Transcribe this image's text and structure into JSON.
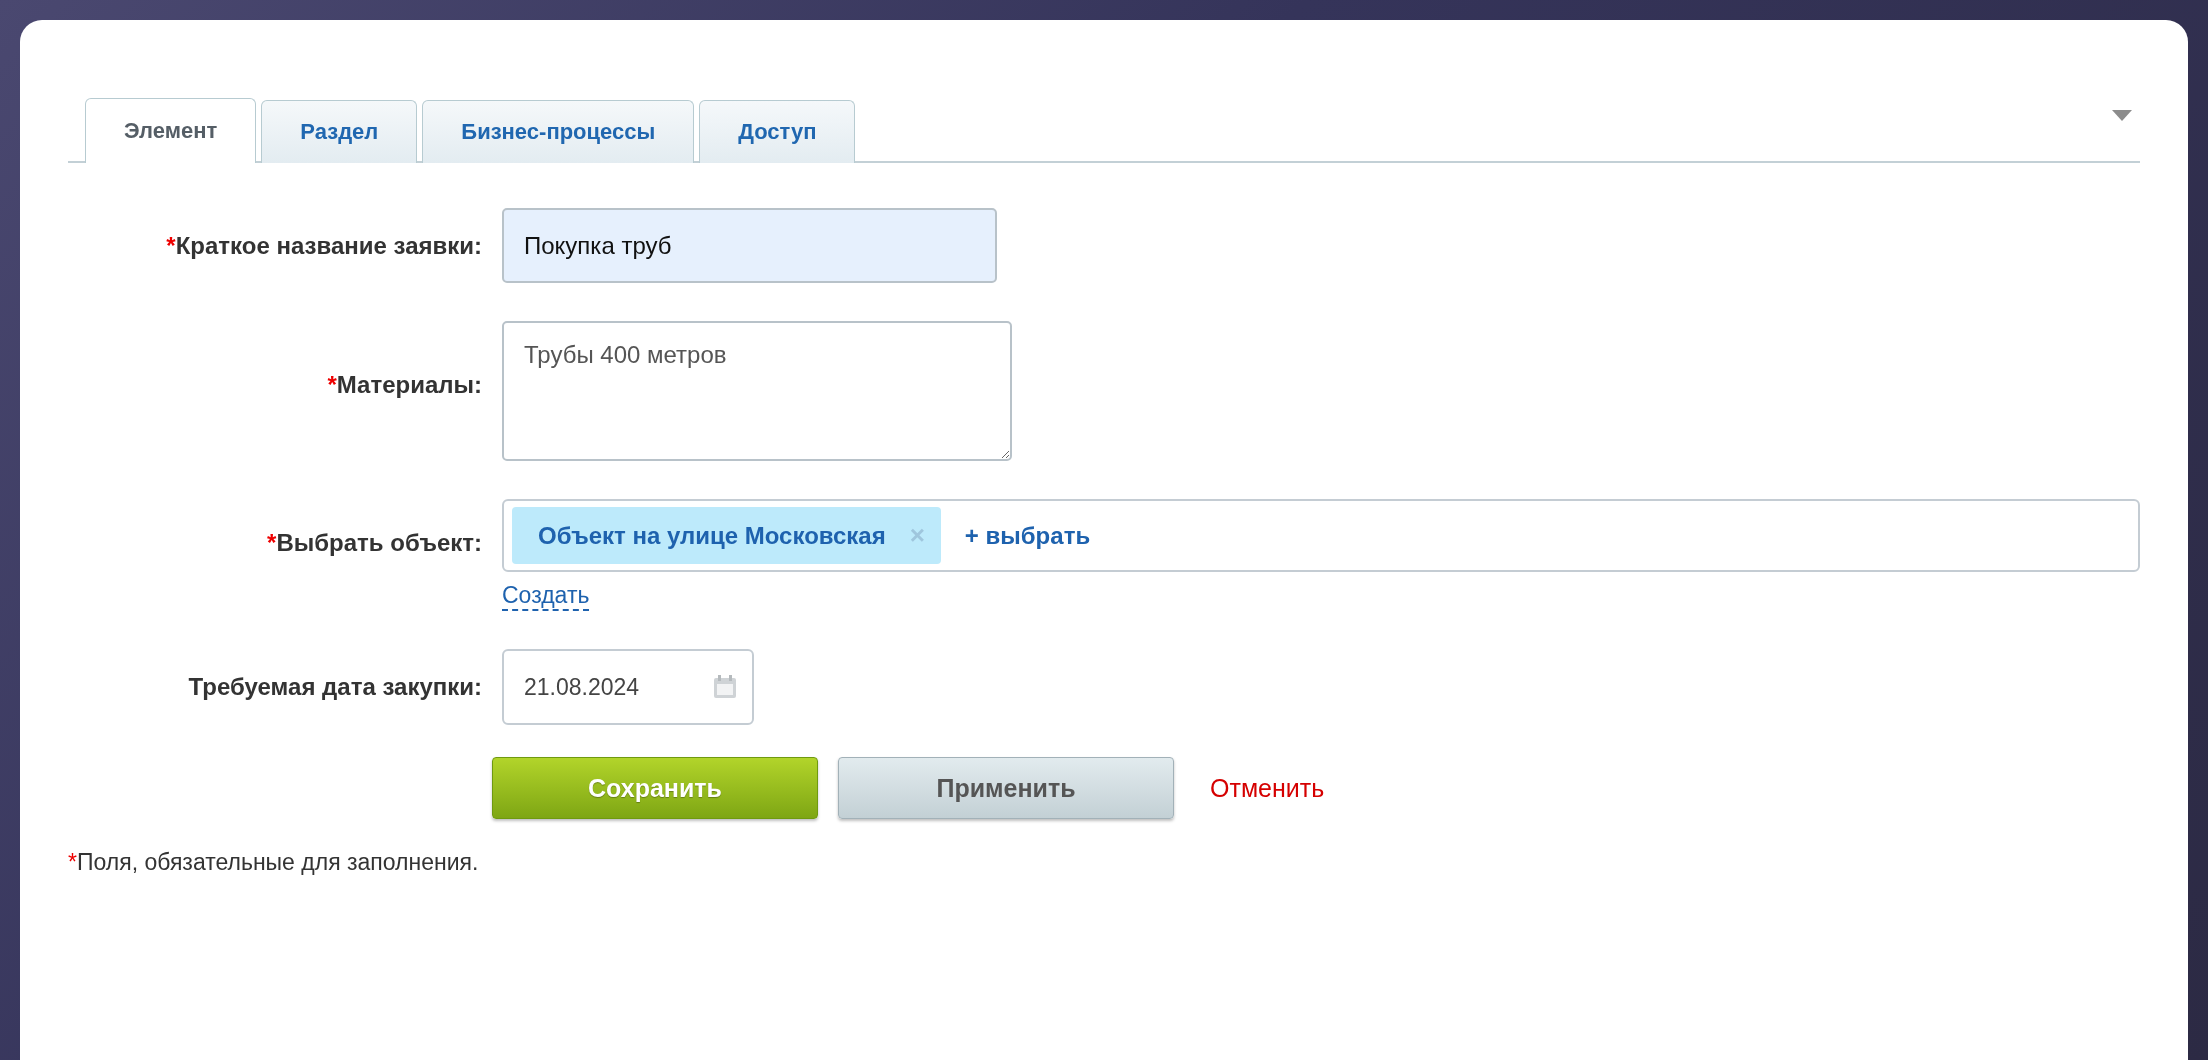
{
  "tabs": [
    {
      "label": "Элемент",
      "selected": true
    },
    {
      "label": "Раздел",
      "selected": false
    },
    {
      "label": "Бизнес-процессы",
      "selected": false
    },
    {
      "label": "Доступ",
      "selected": false
    }
  ],
  "fields": [
    {
      "kind": "text",
      "mark": "*",
      "label": "Краткое название заявки:",
      "value": "Покупка труб"
    },
    {
      "kind": "textarea",
      "mark": "*",
      "label": "Материалы:",
      "value": "Трубы 400 метров"
    },
    {
      "kind": "picker",
      "mark": "*",
      "label": "Выбрать объект:",
      "chips": [
        {
          "label": "Объект на улице Московская",
          "remove": "×"
        }
      ],
      "add_link": "+ выбрать",
      "create_link": "Создать"
    },
    {
      "kind": "date",
      "label": "Требуемая дата закупки:",
      "value": "21.08.2024"
    }
  ],
  "buttons": [
    {
      "kind": "primary",
      "label": "Сохранить"
    },
    {
      "kind": "secondary",
      "label": "Применить"
    },
    {
      "kind": "link",
      "label": "Отменить"
    }
  ],
  "footnote": {
    "mark": "*",
    "text": "Поля, обязательные для заполнения."
  }
}
